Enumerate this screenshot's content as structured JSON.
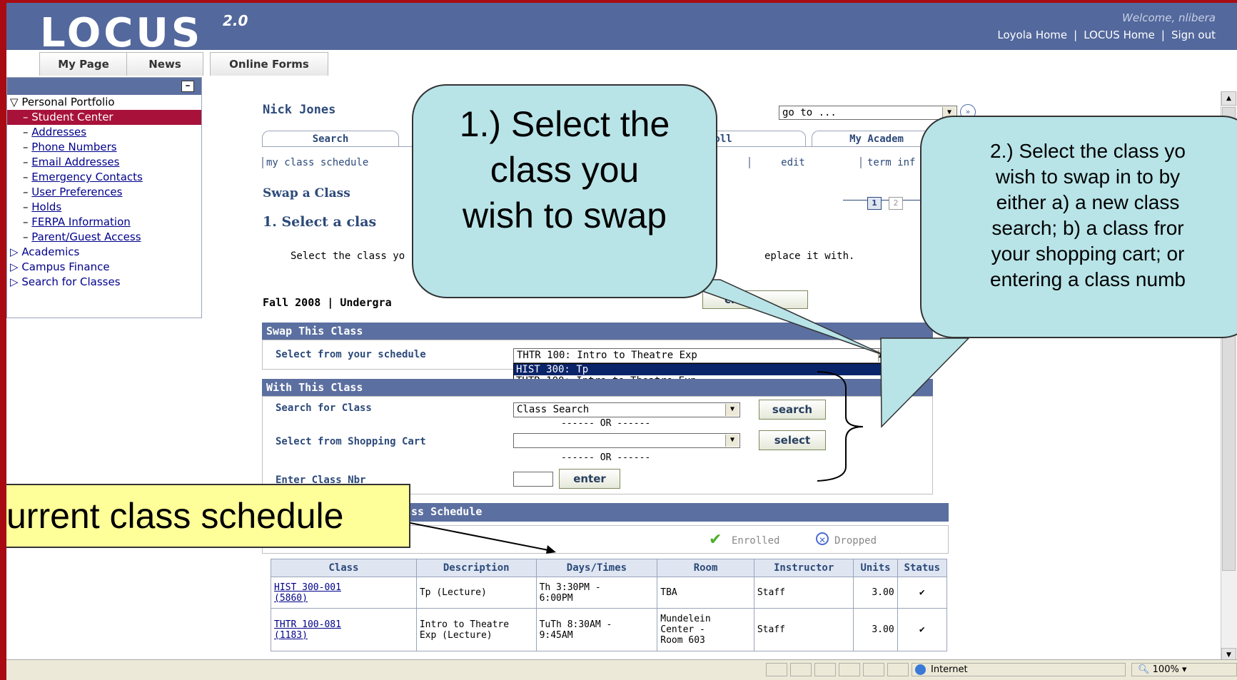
{
  "header": {
    "logo": "LOCUS",
    "version": "2.0",
    "welcome": "Welcome, nlibera",
    "links": [
      "Loyola Home",
      "LOCUS Home",
      "Sign out"
    ]
  },
  "tabs": [
    "My Page",
    "News",
    "Online Forms"
  ],
  "leftnav": {
    "portfolio_label": "Personal Portfolio",
    "items": [
      "Student Center",
      "Addresses",
      "Phone Numbers",
      "Email Addresses",
      "Emergency Contacts",
      "User Preferences",
      "Holds",
      "FERPA Information",
      "Parent/Guest Access"
    ],
    "groups": [
      "Academics",
      "Campus Finance",
      "Search for Classes"
    ]
  },
  "content": {
    "student_name": "Nick Jones",
    "goto_value": "go to ...",
    "tabs": [
      "Search",
      "roll",
      "My Academ"
    ],
    "subtabs": [
      "my class schedule",
      "edit",
      "term inf"
    ],
    "page_title": "Swap a Class",
    "step_title": "1. Select a clas",
    "steps": [
      "1",
      "2"
    ],
    "instruction_left": "Select the class yo",
    "instruction_right": "eplace it with.",
    "term_label": "Fall 2008 | Undergra",
    "change_button": "chang",
    "swap_section": {
      "title": "Swap This Class",
      "label": "Select from your schedule",
      "selected": "THTR 100: Intro to Theatre Exp",
      "options": [
        "HIST 300: Tp",
        "THTR 100: Intro to Theatre Exp"
      ]
    },
    "with_section": {
      "title": "With This Class",
      "search_label": "Search for Class",
      "search_value": "Class Search",
      "search_button": "search",
      "or1": "------ OR ------",
      "cart_label": "Select from Shopping Cart",
      "cart_value": "",
      "select_button": "select",
      "or2": "------ OR ------",
      "nbr_label": "Enter Class Nbr",
      "nbr_value": "",
      "enter_button": "enter"
    },
    "schedule_section": {
      "title": "ass Schedule",
      "legend_enrolled": "Enrolled",
      "legend_dropped": "Dropped",
      "columns": [
        "Class",
        "Description",
        "Days/Times",
        "Room",
        "Instructor",
        "Units",
        "Status"
      ],
      "rows": [
        {
          "class1": "HIST 300-001",
          "class2": "(5860)",
          "description": "Tp (Lecture)",
          "days1": "Th 3:30PM -",
          "days2": "6:00PM",
          "room": "TBA",
          "instructor": "Staff",
          "units": "3.00"
        },
        {
          "class1": "THTR 100-081",
          "class2": "(1183)",
          "description1": "Intro to Theatre",
          "description2": "Exp (Lecture)",
          "days1": "TuTh 8:30AM -",
          "days2": "9:45AM",
          "room1": "Mundelein",
          "room2": "Center -",
          "room3": "Room 603",
          "instructor": "Staff",
          "units": "3.00"
        }
      ]
    }
  },
  "callouts": {
    "c1_line1": "1.) Select the",
    "c1_line2": "class you",
    "c1_line3": "wish to swap",
    "c2_line1": "2.) Select the class yo",
    "c2_line2": "wish to swap in to by",
    "c2_line3": "either a) a new class",
    "c2_line4": "search; b) a class fror",
    "c2_line5": "your shopping cart; or",
    "c2_line6": "entering a class numb",
    "c3": "urrent class schedule"
  },
  "statusbar": {
    "zone": "Internet",
    "zoom": "100%"
  },
  "colors": {
    "header": "#53689c",
    "callout": "#b8e4e8",
    "yellow_callout": "#ffff99",
    "border": "#a80c12"
  }
}
